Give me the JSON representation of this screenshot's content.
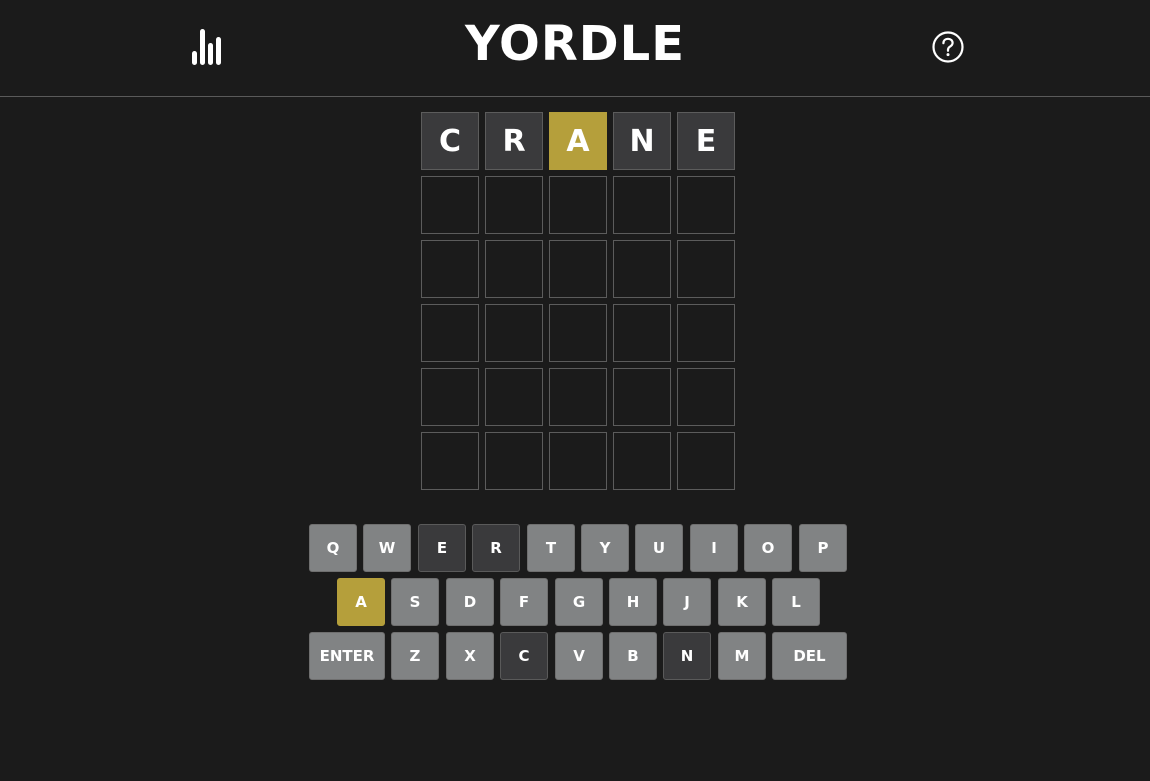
{
  "header": {
    "title": "YORDLE",
    "stats_icon": "bar-chart-icon",
    "help_icon": "question-circle-icon"
  },
  "colors": {
    "background": "#1b1b1b",
    "absent": "#3a3a3c",
    "present": "#b59f3b",
    "key_default": "#818384"
  },
  "board": {
    "rows": [
      [
        {
          "letter": "C",
          "state": "absent"
        },
        {
          "letter": "R",
          "state": "absent"
        },
        {
          "letter": "A",
          "state": "present"
        },
        {
          "letter": "N",
          "state": "absent"
        },
        {
          "letter": "E",
          "state": "absent"
        }
      ],
      [
        {
          "letter": "",
          "state": "empty"
        },
        {
          "letter": "",
          "state": "empty"
        },
        {
          "letter": "",
          "state": "empty"
        },
        {
          "letter": "",
          "state": "empty"
        },
        {
          "letter": "",
          "state": "empty"
        }
      ],
      [
        {
          "letter": "",
          "state": "empty"
        },
        {
          "letter": "",
          "state": "empty"
        },
        {
          "letter": "",
          "state": "empty"
        },
        {
          "letter": "",
          "state": "empty"
        },
        {
          "letter": "",
          "state": "empty"
        }
      ],
      [
        {
          "letter": "",
          "state": "empty"
        },
        {
          "letter": "",
          "state": "empty"
        },
        {
          "letter": "",
          "state": "empty"
        },
        {
          "letter": "",
          "state": "empty"
        },
        {
          "letter": "",
          "state": "empty"
        }
      ],
      [
        {
          "letter": "",
          "state": "empty"
        },
        {
          "letter": "",
          "state": "empty"
        },
        {
          "letter": "",
          "state": "empty"
        },
        {
          "letter": "",
          "state": "empty"
        },
        {
          "letter": "",
          "state": "empty"
        }
      ],
      [
        {
          "letter": "",
          "state": "empty"
        },
        {
          "letter": "",
          "state": "empty"
        },
        {
          "letter": "",
          "state": "empty"
        },
        {
          "letter": "",
          "state": "empty"
        },
        {
          "letter": "",
          "state": "empty"
        }
      ]
    ]
  },
  "keyboard": {
    "row1": [
      {
        "label": "Q",
        "state": "default"
      },
      {
        "label": "W",
        "state": "default"
      },
      {
        "label": "E",
        "state": "absent"
      },
      {
        "label": "R",
        "state": "absent"
      },
      {
        "label": "T",
        "state": "default"
      },
      {
        "label": "Y",
        "state": "default"
      },
      {
        "label": "U",
        "state": "default"
      },
      {
        "label": "I",
        "state": "default"
      },
      {
        "label": "O",
        "state": "default"
      },
      {
        "label": "P",
        "state": "default"
      }
    ],
    "row2": [
      {
        "label": "A",
        "state": "present"
      },
      {
        "label": "S",
        "state": "default"
      },
      {
        "label": "D",
        "state": "default"
      },
      {
        "label": "F",
        "state": "default"
      },
      {
        "label": "G",
        "state": "default"
      },
      {
        "label": "H",
        "state": "default"
      },
      {
        "label": "J",
        "state": "default"
      },
      {
        "label": "K",
        "state": "default"
      },
      {
        "label": "L",
        "state": "default"
      }
    ],
    "row3": [
      {
        "label": "ENTER",
        "state": "default"
      },
      {
        "label": "Z",
        "state": "default"
      },
      {
        "label": "X",
        "state": "default"
      },
      {
        "label": "C",
        "state": "absent"
      },
      {
        "label": "V",
        "state": "default"
      },
      {
        "label": "B",
        "state": "default"
      },
      {
        "label": "N",
        "state": "absent"
      },
      {
        "label": "M",
        "state": "default"
      },
      {
        "label": "DEL",
        "state": "default"
      }
    ]
  }
}
